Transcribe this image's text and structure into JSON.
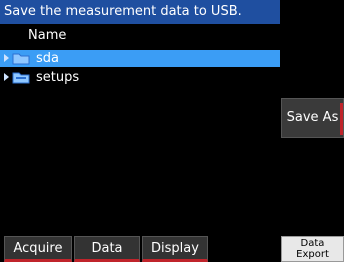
{
  "title": "Save the measurement data to USB.",
  "file_list": {
    "column_header": "Name",
    "items": [
      {
        "label": "sda",
        "selected": true,
        "icon": "folder-icon"
      },
      {
        "label": "setups",
        "selected": false,
        "icon": "folder-icon"
      }
    ]
  },
  "side_button": {
    "label": "Save As"
  },
  "bottom_tabs": [
    {
      "label": "Acquire"
    },
    {
      "label": "Data"
    },
    {
      "label": "Display"
    }
  ],
  "data_export": {
    "line1": "Data",
    "line2": "Export"
  },
  "colors": {
    "title_bg": "#1f4fa0",
    "selection": "#3b9df5",
    "accent": "#c0242b"
  }
}
